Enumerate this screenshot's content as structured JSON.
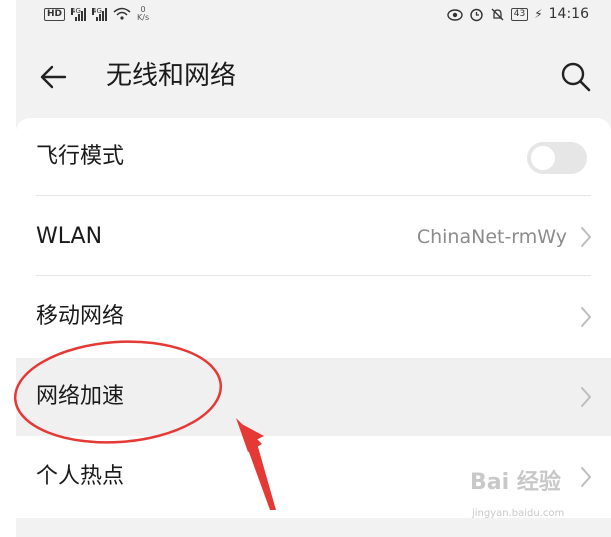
{
  "status_bar": {
    "left_icons": [
      "hd-icon",
      "signal-4g-icon",
      "signal-4g-icon",
      "wifi-icon"
    ],
    "hd_label": "HD",
    "network_type_1": "4G",
    "network_type_2": "4G",
    "speed_value": "0",
    "speed_unit": "K/s",
    "right_icons": [
      "eye-comfort-icon",
      "alarm-icon",
      "mute-icon",
      "battery-icon",
      "charging-icon"
    ],
    "battery_level": "43",
    "time": "14:16"
  },
  "app_bar": {
    "title": "无线和网络",
    "back_icon": "arrow-left-icon",
    "search_icon": "search-icon"
  },
  "settings": [
    {
      "label": "飞行模式",
      "type": "toggle",
      "enabled": false
    },
    {
      "label": "WLAN",
      "type": "link",
      "value": "ChinaNet-rmWy"
    },
    {
      "label": "移动网络",
      "type": "link"
    },
    {
      "label": "网络加速",
      "type": "link",
      "highlighted": true
    },
    {
      "label": "个人热点",
      "type": "link"
    }
  ],
  "annotation": {
    "shape": "red-ellipse-and-arrow",
    "target": "网络加速",
    "color": "#e53935"
  },
  "watermark": {
    "main": "Bai 经验",
    "sub": "jingyan.baidu.com"
  }
}
